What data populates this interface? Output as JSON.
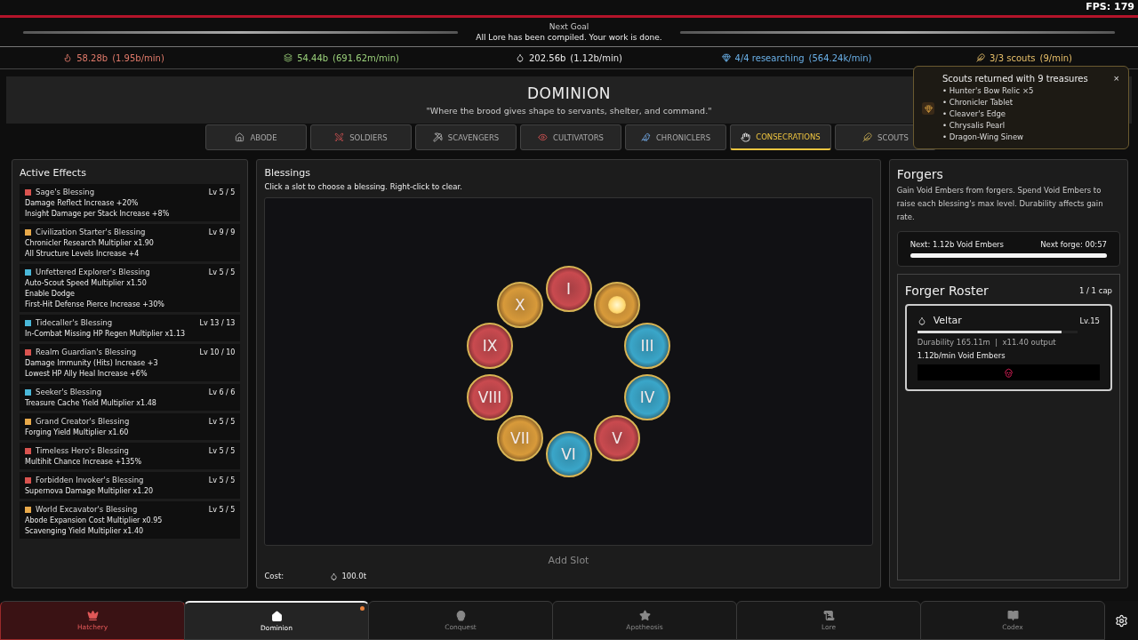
{
  "fps": "FPS: 179",
  "goal": {
    "title": "Next Goal",
    "text": "All Lore has been compiled. Your work is done.",
    "level": 1
  },
  "resources": [
    {
      "amount": "58.28b",
      "rate": "(1.95b/min)",
      "color": "#e07a6a"
    },
    {
      "amount": "54.44b",
      "rate": "(691.62m/min)",
      "color": "#9ad07a"
    },
    {
      "amount": "202.56b",
      "rate": "(1.12b/min)",
      "color": "#e8e8e8"
    },
    {
      "amount": "4/4 researching",
      "rate": "(564.24k/min)",
      "color": "#6ab0e8"
    },
    {
      "amount": "3/3 scouts",
      "rate": "(9/min)",
      "color": "#e8c06a"
    }
  ],
  "header": {
    "title": "DOMINION",
    "subtitle": "\"Where the brood gives shape to servants, shelter, and command.\""
  },
  "tabs": [
    {
      "label": "ABODE",
      "selected": false
    },
    {
      "label": "SOLDIERS",
      "selected": false
    },
    {
      "label": "SCAVENGERS",
      "selected": false
    },
    {
      "label": "CULTIVATORS",
      "selected": false
    },
    {
      "label": "CHRONICLERS",
      "selected": false
    },
    {
      "label": "CONSECRATIONS",
      "selected": true
    },
    {
      "label": "SCOUTS",
      "selected": false
    }
  ],
  "toast": {
    "title": "Scouts returned with 9 treasures",
    "close": "×",
    "items": [
      "• Hunter's Bow Relic ×5",
      "• Chronicler Tablet",
      "• Cleaver's Edge",
      "• Chrysalis Pearl",
      "• Dragon-Wing Sinew"
    ]
  },
  "active_effects": {
    "title": "Active Effects",
    "items": [
      {
        "name": "Sage's Blessing",
        "level": "Lv 5 / 5",
        "color": "#d9534f",
        "effects": [
          "Damage Reflect Increase +20%",
          "Insight Damage per Stack Increase +8%"
        ]
      },
      {
        "name": "Civilization Starter's Blessing",
        "level": "Lv 9 / 9",
        "color": "#e8a94a",
        "effects": [
          "Chronicler Research Multiplier x1.90",
          "All Structure Levels Increase +4"
        ]
      },
      {
        "name": "Unfettered Explorer's Blessing",
        "level": "Lv 5 / 5",
        "color": "#4ab8d9",
        "effects": [
          "Auto-Scout Speed Multiplier x1.50",
          "Enable Dodge",
          "First-Hit Defense Pierce Increase +30%"
        ]
      },
      {
        "name": "Tidecaller's Blessing",
        "level": "Lv 13 / 13",
        "color": "#4ab8d9",
        "effects": [
          "In-Combat Missing HP Regen Multiplier x1.13"
        ]
      },
      {
        "name": "Realm Guardian's Blessing",
        "level": "Lv 10 / 10",
        "color": "#d9534f",
        "effects": [
          "Damage Immunity (Hits) Increase +3",
          "Lowest HP Ally Heal Increase +6%"
        ]
      },
      {
        "name": "Seeker's Blessing",
        "level": "Lv 6 / 6",
        "color": "#4ab8d9",
        "effects": [
          "Treasure Cache Yield Multiplier x1.48"
        ]
      },
      {
        "name": "Grand Creator's Blessing",
        "level": "Lv 5 / 5",
        "color": "#e8a94a",
        "effects": [
          "Forging Yield Multiplier x1.60"
        ]
      },
      {
        "name": "Timeless Hero's Blessing",
        "level": "Lv 5 / 5",
        "color": "#d9534f",
        "effects": [
          "Multihit Chance Increase +135%"
        ]
      },
      {
        "name": "Forbidden Invoker's Blessing",
        "level": "Lv 5 / 5",
        "color": "#d9534f",
        "effects": [
          "Supernova Damage Multiplier x1.20"
        ]
      },
      {
        "name": "World Excavator's Blessing",
        "level": "Lv 5 / 5",
        "color": "#e8a94a",
        "effects": [
          "Abode Expansion Cost Multiplier x0.95",
          "Scavenging Yield Multiplier x1.40"
        ]
      }
    ]
  },
  "blessings": {
    "title": "Blessings",
    "hint": "Click a slot to choose a blessing. Right-click to clear.",
    "slots": [
      {
        "label": "I",
        "color": "#c94a4f"
      },
      {
        "color": "#d89a3a"
      },
      {
        "label": "III",
        "color": "#3aa6c9"
      },
      {
        "label": "IV",
        "color": "#3aa6c9"
      },
      {
        "label": "V",
        "color": "#c94a4f"
      },
      {
        "label": "VI",
        "color": "#3aa6c9"
      },
      {
        "label": "VII",
        "color": "#d89a3a"
      },
      {
        "label": "VIII",
        "color": "#c94a4f"
      },
      {
        "label": "IX",
        "color": "#c94a4f"
      },
      {
        "label": "X",
        "color": "#d89a3a"
      }
    ],
    "add_slot": "Add Slot",
    "cost_label": "Cost:",
    "cost": "100.0t"
  },
  "forgers": {
    "title": "Forgers",
    "description": "Gain Void Embers from forgers. Spend Void Embers  to raise each blessing's max level. Durability affects gain rate.",
    "next": "Next: 1.12b Void Embers",
    "next_forge": "Next forge: 00:57",
    "level": 1,
    "roster": {
      "title": "Forger Roster",
      "cap": "1 / 1 cap",
      "forger": {
        "name": "Veltar",
        "lv": "Lv.15",
        "level": 0.9,
        "durability": "Durability 165.11m  |  x11.40 output",
        "rate": "1.12b/min Void Embers"
      }
    }
  },
  "bottom_nav": [
    {
      "label": "Hatchery",
      "selected": false,
      "alert": true,
      "dot": false
    },
    {
      "label": "Dominion",
      "selected": true,
      "alert": false,
      "dot": true
    },
    {
      "label": "Conquest",
      "selected": false,
      "alert": false,
      "dot": false
    },
    {
      "label": "Apotheosis",
      "selected": false,
      "alert": false,
      "dot": false
    },
    {
      "label": "Lore",
      "selected": false,
      "alert": false,
      "dot": false
    },
    {
      "label": "Codex",
      "selected": false,
      "alert": false,
      "dot": false
    }
  ]
}
